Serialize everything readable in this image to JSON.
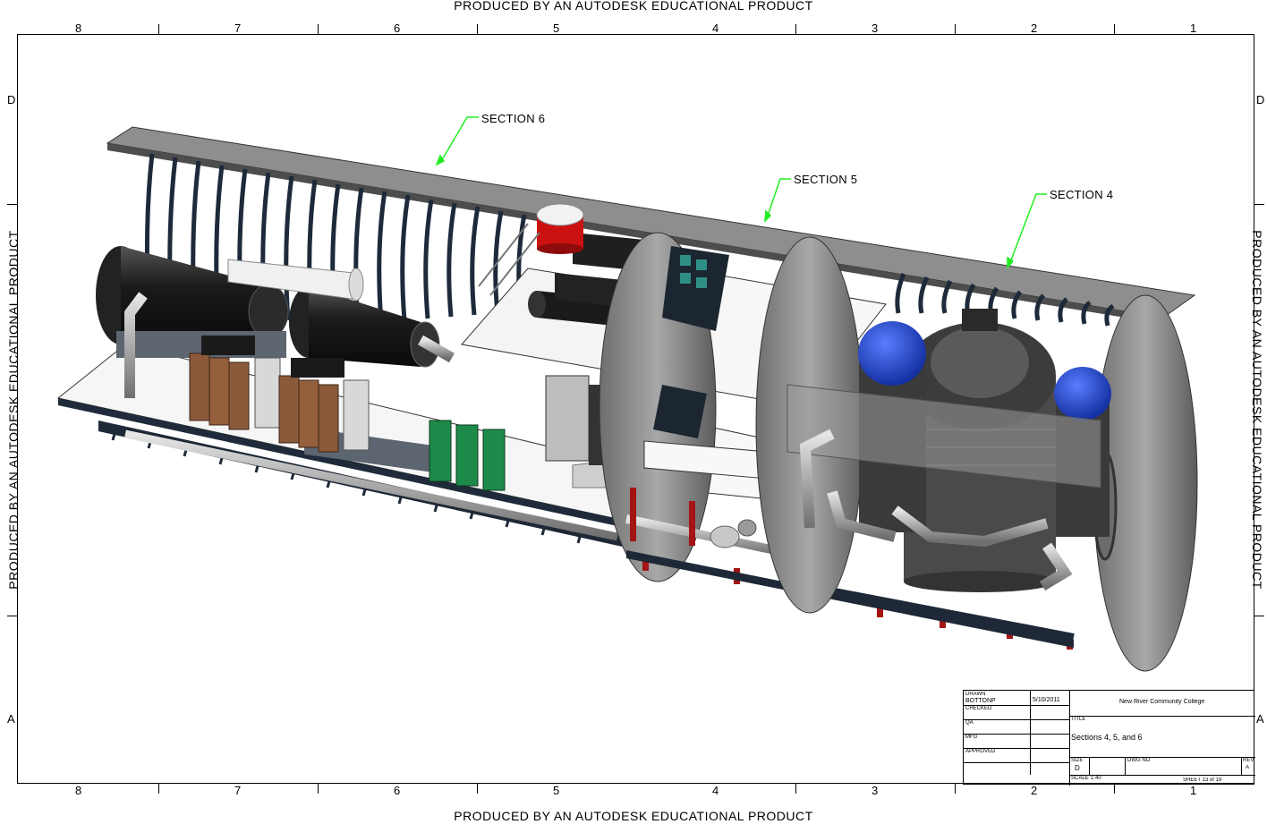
{
  "watermark": "PRODUCED BY AN AUTODESK EDUCATIONAL PRODUCT",
  "zones": {
    "columns": [
      "8",
      "7",
      "6",
      "5",
      "4",
      "3",
      "2",
      "1"
    ],
    "rows": [
      "D",
      "A"
    ]
  },
  "callouts": {
    "section6": "SECTION 6",
    "section5": "SECTION 5",
    "section4": "SECTION 4"
  },
  "title_block": {
    "drawn_label": "DRAWN",
    "drawn_by": "BOTTONP",
    "date": "5/10/2011",
    "company": "New River Community College",
    "checked_label": "CHECKED",
    "qa_label": "QA",
    "title_label": "TITLE",
    "mfg_label": "MFG",
    "title": "Sections 4, 5, and 6",
    "approved_label": "APPROVED",
    "size_label": "SIZE",
    "size": "D",
    "dwg_label": "DWG NO",
    "rev_label": "REV",
    "rev": "A",
    "scale_label": "SCALE",
    "scale": "1:40",
    "sheet": "SHEET  13 of 19"
  },
  "colors": {
    "callout_leader": "#22ee22",
    "hull": "#8c8c8c",
    "hull_dark": "#5a5a5a",
    "frames": "#2b3a4a",
    "deck": "#f4f4f4",
    "tank_red": "#cc1111",
    "dome_blue": "#1b3fc8",
    "cabinet_brown": "#8a5a3a",
    "cabinet_green": "#1e8a4a",
    "bracket_red": "#a31515"
  }
}
